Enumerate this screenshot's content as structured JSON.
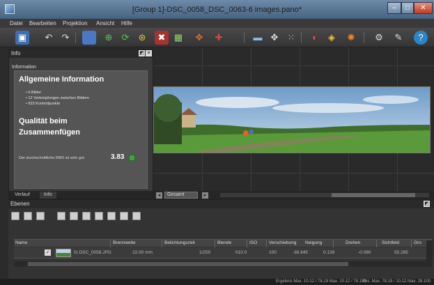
{
  "window": {
    "title": "[Group 1]-DSC_0058_DSC_0063-6 images.pano*",
    "minimize": "–",
    "maximize": "□",
    "close": "✕"
  },
  "menu": [
    "Datei",
    "Bearbeiten",
    "Projektion",
    "Ansicht",
    "Hilfe"
  ],
  "toolbar_icons": [
    "save-icon",
    "undo-icon",
    "redo-icon",
    "export-icon",
    "crop-icon",
    "rotate-icon",
    "align-icon",
    "control-points-icon",
    "projection-icon",
    "compare-icon",
    "zoom-icon",
    "move-icon",
    "select-icon",
    "hdr-icon",
    "color-icon",
    "exposure-icon",
    "settings-icon",
    "tools-icon",
    "help-icon"
  ],
  "info_panel": {
    "title": "Info",
    "section": "Information",
    "general_heading": "Allgemeine Information",
    "bullets": [
      "• 6 Bilder",
      "• 12 Verknüpfungen zwischen Bildern",
      "• 633 Kontrollpunkte"
    ],
    "quality_heading_1": "Qualität beim",
    "quality_heading_2": "Zusammenfügen",
    "quality_text": "Der durchschnittliche RMS ist sehr gut:",
    "quality_value": "3.83",
    "tabs": [
      "Verlauf",
      "Info"
    ]
  },
  "viewport": {
    "zoom_label": "Gesamt"
  },
  "layers_panel": {
    "title": "Ebenen",
    "columns": [
      "Name",
      "Brennweite",
      "Belichtungszeit",
      "Blende",
      "ISO",
      "Verschiebung",
      "Neigung",
      "Drehen",
      "Sichtfeld",
      "Gro"
    ],
    "rows": [
      {
        "checked": "✓",
        "name": "0) DSC_0058.JPG",
        "brennweite": "22.00 mm",
        "belichtungszeit": "1/250",
        "blende": "f/10.0",
        "iso": "100",
        "verschiebung": "-38.845",
        "neigung": "0.139",
        "drehen": "-0.080",
        "sichtfeld": "55.285"
      }
    ]
  },
  "status": {
    "left": "Ergebnis Max. 10.12 / 78.19 Max. 10.12 / 78.190",
    "right": "Abs. Max. 78.19 / 10.12 Max. 28.100"
  },
  "colors": {
    "window_bg": "#2b2b2b",
    "titlebar": "#5e7b99",
    "panel": "#3a3a3a",
    "accent_green": "#3fa33f"
  }
}
